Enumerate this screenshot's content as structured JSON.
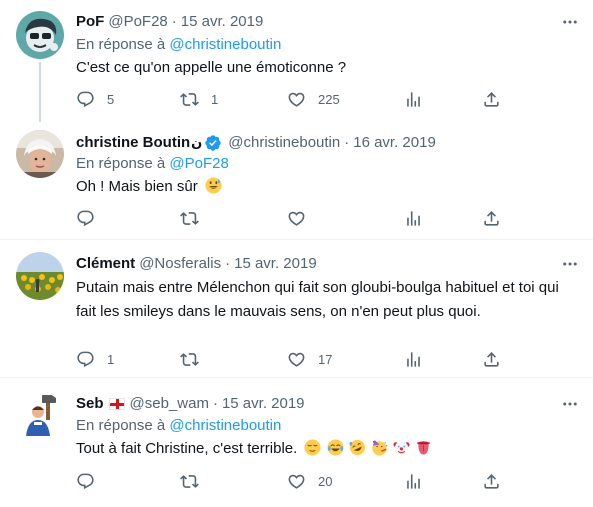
{
  "tweets": [
    {
      "name": "PoF",
      "handle": "@PoF28",
      "dot": "·",
      "date": "15 avr. 2019",
      "reply_prefix": "En réponse à",
      "reply_mention": "@christineboutin",
      "text": "C'est ce qu'on appelle une émoticonne ?",
      "counts": {
        "reply": "5",
        "retweet": "1",
        "like": "225"
      }
    },
    {
      "name": "christine Boutin",
      "name_suffix": "ن",
      "verified": true,
      "handle": "@christineboutin",
      "dot": "·",
      "date": "16 avr. 2019",
      "reply_prefix": "En réponse à",
      "reply_mention": "@PoF28",
      "text": "Oh ! Mais bien sûr",
      "emojis": [
        "grinning-sweat-emoji"
      ]
    },
    {
      "name": "Clément",
      "handle": "@Nosferalis",
      "dot": "·",
      "date": "15 avr. 2019",
      "text_line1": "Putain mais entre Mélenchon qui fait son gloubi-boulga habituel et toi qui",
      "text_line2": "fait les smileys dans le mauvais sens, on n'en peut plus quoi.",
      "counts": {
        "reply": "1",
        "like": "17"
      }
    },
    {
      "name": "Seb",
      "flag": "guernsey-flag",
      "handle": "@seb_wam",
      "dot": "·",
      "date": "15 avr. 2019",
      "reply_prefix": "En réponse à",
      "reply_mention": "@christineboutin",
      "text": "Tout à fait Christine, c'est terrible.",
      "emojis": [
        "relieved-face-emoji",
        "tears-of-joy-emoji",
        "rolling-laughing-emoji",
        "partying-face-emoji",
        "clown-face-emoji",
        "tongue-emoji"
      ],
      "counts": {
        "like": "20"
      }
    }
  ],
  "icons": [
    "reply-icon",
    "retweet-icon",
    "like-icon",
    "views-icon",
    "share-icon",
    "more-icon"
  ],
  "colors": {
    "link": "#1d9bf0",
    "muted": "#536471",
    "text": "#0f1419",
    "verified": "#1d9bf0"
  }
}
